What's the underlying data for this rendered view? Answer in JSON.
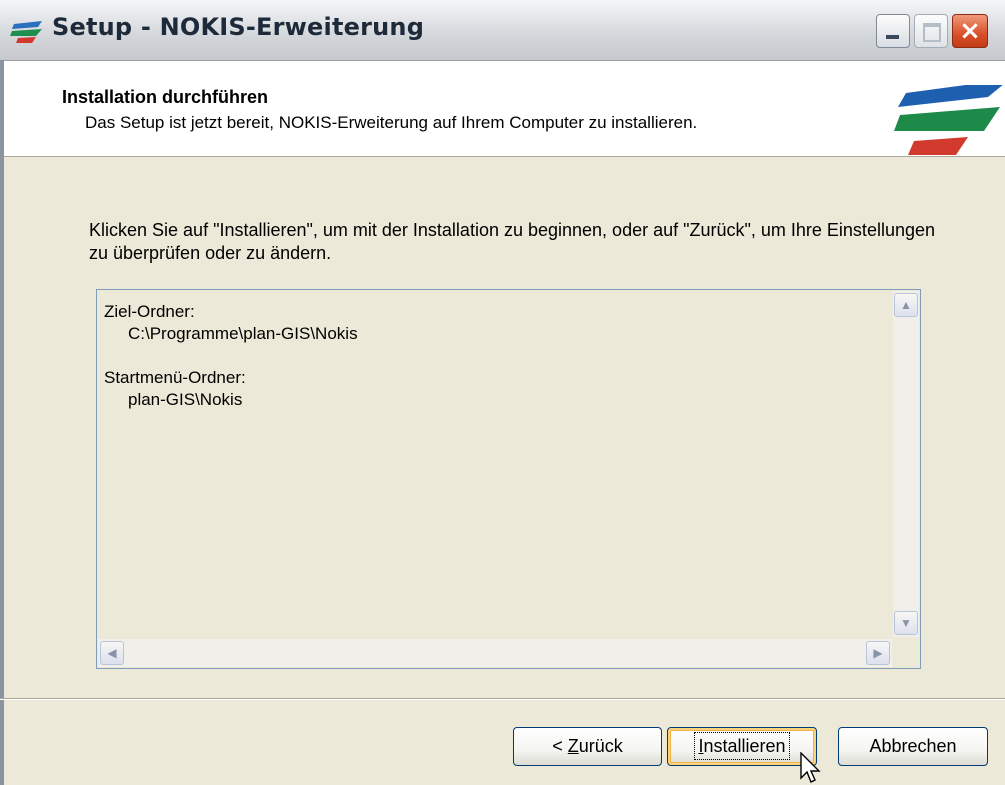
{
  "window": {
    "title": "Setup - NOKIS-Erweiterung",
    "controls": {
      "minimize": "minimize",
      "maximize": "maximize",
      "close": "×"
    }
  },
  "header": {
    "title": "Installation durchführen",
    "subtitle": "Das Setup ist jetzt bereit, NOKIS-Erweiterung auf Ihrem Computer zu installieren."
  },
  "body": {
    "instruction": "Klicken Sie auf \"Installieren\", um mit der Installation zu beginnen, oder auf \"Zurück\", um Ihre Einstellungen zu überprüfen oder zu ändern.",
    "summary": {
      "target_label": "Ziel-Ordner:",
      "target_value": "C:\\Programme\\plan-GIS\\Nokis",
      "startmenu_label": "Startmenü-Ordner:",
      "startmenu_value": "plan-GIS\\Nokis"
    }
  },
  "buttons": {
    "back_prefix": "< ",
    "back_mnemonic": "Z",
    "back_rest": "urück",
    "install_mnemonic": "I",
    "install_rest": "nstallieren",
    "cancel": "Abbrechen"
  },
  "colors": {
    "logo_blue": "#1f5fb0",
    "logo_green": "#1e8a4a",
    "logo_red": "#d23a2e"
  }
}
